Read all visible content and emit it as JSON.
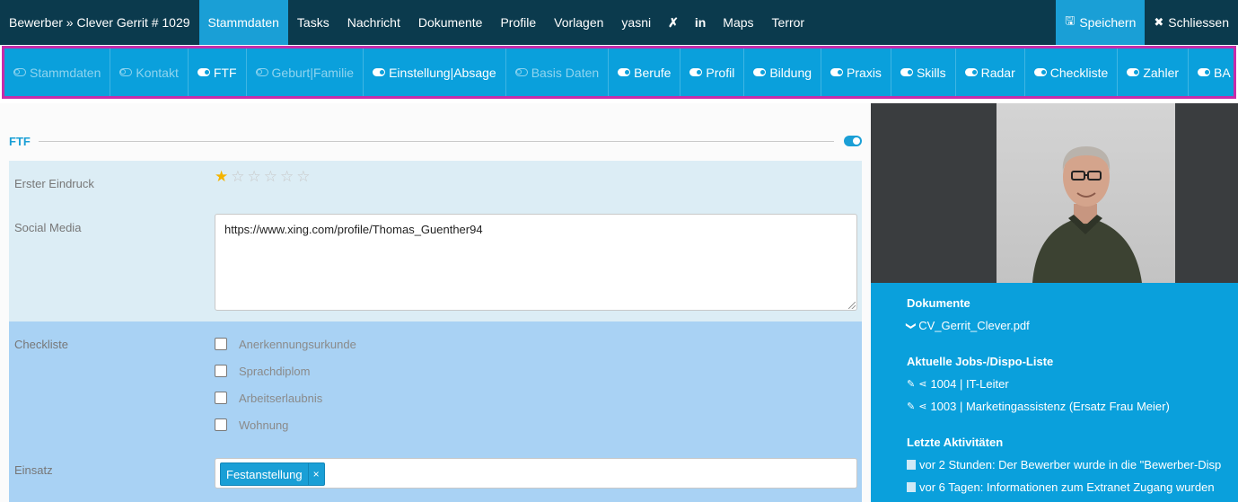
{
  "topbar": {
    "breadcrumb": "Bewerber » Clever Gerrit # 1029",
    "nav": [
      "Stammdaten",
      "Tasks",
      "Nachricht",
      "Dokumente",
      "Profile",
      "Vorlagen",
      "yasni"
    ],
    "xing_glyph": "✗",
    "linkedin_label": "in",
    "nav_after": [
      "Maps",
      "Terror"
    ],
    "save_label": "Speichern",
    "close_label": "Schliessen"
  },
  "subnav": {
    "items": [
      {
        "label": "Stammdaten",
        "on": false
      },
      {
        "label": "Kontakt",
        "on": false
      },
      {
        "label": "FTF",
        "on": true
      },
      {
        "label": "Geburt|Familie",
        "on": false
      },
      {
        "label": "Einstellung|Absage",
        "on": true
      },
      {
        "label": "Basis Daten",
        "on": false
      },
      {
        "label": "Berufe",
        "on": true
      },
      {
        "label": "Profil",
        "on": true
      },
      {
        "label": "Bildung",
        "on": true
      },
      {
        "label": "Praxis",
        "on": true
      },
      {
        "label": "Skills",
        "on": true
      },
      {
        "label": "Radar",
        "on": true
      },
      {
        "label": "Checkliste",
        "on": true
      },
      {
        "label": "Zahler",
        "on": true
      },
      {
        "label": "BA",
        "on": true
      }
    ]
  },
  "section": {
    "title": "FTF",
    "first_impression_label": "Erster Eindruck",
    "rating": 1,
    "rating_max": 6,
    "social_label": "Social Media",
    "social_value": "https://www.xing.com/profile/Thomas_Guenther94",
    "checklist_label": "Checkliste",
    "checklist": [
      "Anerkennungsurkunde",
      "Sprachdiplom",
      "Arbeitserlaubnis",
      "Wohnung"
    ],
    "einsatz_label": "Einsatz",
    "einsatz_tag": "Festanstellung",
    "tag_remove": "×"
  },
  "right": {
    "documents_title": "Dokumente",
    "document": "CV_Gerrit_Clever.pdf",
    "jobs_title": "Aktuelle Jobs-/Dispo-Liste",
    "jobs": [
      "1004 | IT-Leiter",
      "1003 | Marketingassistenz (Ersatz Frau Meier)"
    ],
    "activities_title": "Letzte Aktivitäten",
    "activities": [
      "vor 2 Stunden: Der Bewerber wurde in die \"Bewerber-Disp",
      "vor 6 Tagen: Informationen zum Extranet Zugang wurden"
    ]
  },
  "colors": {
    "topbar": "#0b3a4d",
    "accent": "#1a9fd6",
    "subnav": "#0aa0dc",
    "highlight_border": "#c72ca9"
  }
}
